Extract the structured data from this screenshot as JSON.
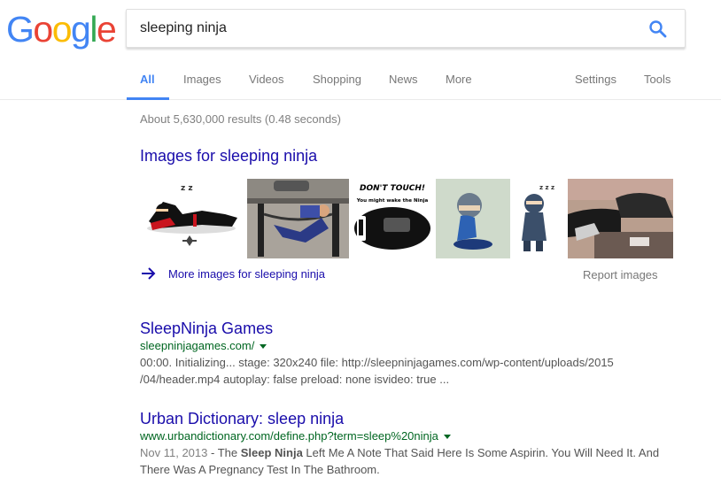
{
  "logo": {
    "letters": [
      "G",
      "o",
      "o",
      "g",
      "l",
      "e"
    ],
    "colors": [
      "#4285f4",
      "#ea4335",
      "#fbbc05",
      "#4285f4",
      "#34a853",
      "#ea4335"
    ]
  },
  "search": {
    "query": "sleeping ninja",
    "icon": "search-icon",
    "accent": "#4285f4"
  },
  "tabs": [
    {
      "label": "All",
      "active": true
    },
    {
      "label": "Images"
    },
    {
      "label": "Videos"
    },
    {
      "label": "Shopping"
    },
    {
      "label": "News"
    },
    {
      "label": "More"
    },
    {
      "label": "Settings"
    },
    {
      "label": "Tools"
    }
  ],
  "stats": "About 5,630,000 results (0.48 seconds)",
  "images_block": {
    "heading": "Images for sleeping ninja",
    "thumbnail_labels": {
      "dont_touch": "DON'T TOUCH!",
      "wake": "You might wake the Ninja",
      "zzz_small": "z z",
      "zzz_big": "z z z"
    },
    "more_link": "More images for sleeping ninja",
    "report": "Report images"
  },
  "results": [
    {
      "title": "SleepNinja Games",
      "url": "sleepninjagames.com/",
      "snippet_line1": "00:00. Initializing... stage: 320x240 file: http://sleepninjagames.com/wp-content/uploads/2015",
      "snippet_line2": "/04/header.mp4 autoplay: false preload: none isvideo: true ..."
    },
    {
      "title": "Urban Dictionary: sleep ninja",
      "url": "www.urbandictionary.com/define.php?term=sleep%20ninja",
      "date": "Nov 11, 2013",
      "dash": " - The ",
      "bold1": "Sleep Ninja",
      "mid": " Left Me A Note That Said Here Is Some Aspirin. You Will Need It. And",
      "line2": "There Was A Pregnancy Test In The Bathroom."
    }
  ]
}
